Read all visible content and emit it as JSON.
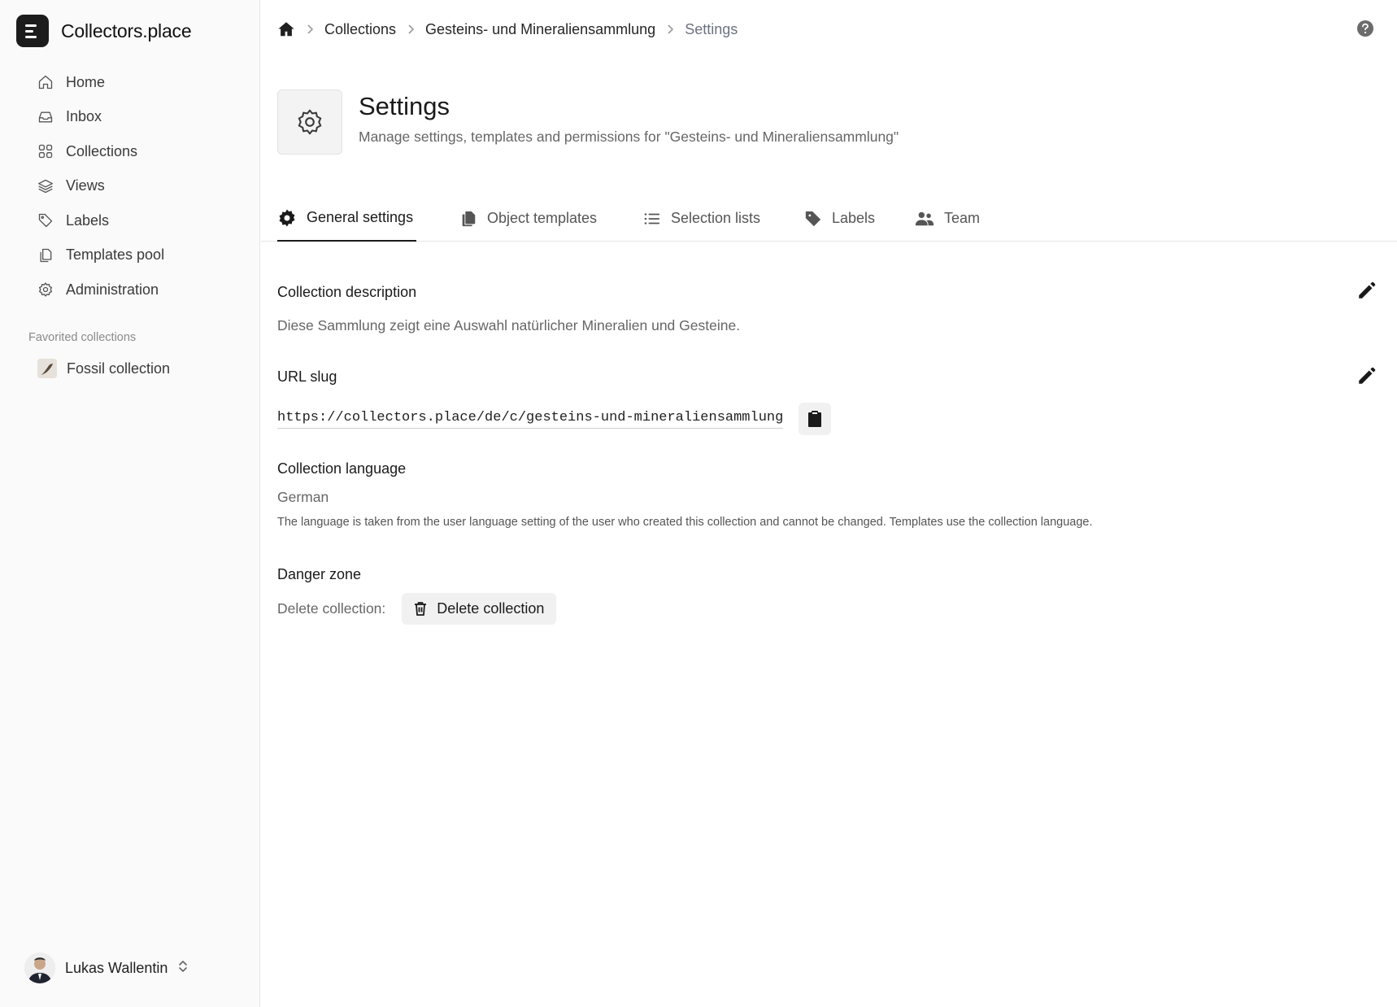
{
  "app": {
    "name": "Collectors.place"
  },
  "sidebar": {
    "items": [
      {
        "label": "Home",
        "icon": "home-icon"
      },
      {
        "label": "Inbox",
        "icon": "inbox-icon"
      },
      {
        "label": "Collections",
        "icon": "grid-icon"
      },
      {
        "label": "Views",
        "icon": "layers-icon"
      },
      {
        "label": "Labels",
        "icon": "tag-icon"
      },
      {
        "label": "Templates pool",
        "icon": "copy-icon"
      },
      {
        "label": "Administration",
        "icon": "gear-icon"
      }
    ],
    "favorites_title": "Favorited collections",
    "favorites": [
      {
        "label": "Fossil collection"
      }
    ],
    "user": {
      "name": "Lukas Wallentin"
    }
  },
  "breadcrumb": {
    "items": [
      "Collections",
      "Gesteins- und Mineraliensammlung"
    ],
    "current": "Settings"
  },
  "header": {
    "title": "Settings",
    "subtitle": "Manage settings, templates and permissions for \"Gesteins- und Mineraliensammlung\""
  },
  "tabs": [
    {
      "label": "General settings",
      "icon": "gear-solid-icon",
      "active": true
    },
    {
      "label": "Object templates",
      "icon": "copy-solid-icon",
      "active": false
    },
    {
      "label": "Selection lists",
      "icon": "list-icon",
      "active": false
    },
    {
      "label": "Labels",
      "icon": "tag-solid-icon",
      "active": false
    },
    {
      "label": "Team",
      "icon": "users-icon",
      "active": false
    }
  ],
  "settings": {
    "description": {
      "title": "Collection description",
      "value": "Diese Sammlung zeigt eine Auswahl natürlicher Mineralien und Gesteine."
    },
    "slug": {
      "title": "URL slug",
      "value": "https://collectors.place/de/c/gesteins-und-mineraliensammlung"
    },
    "language": {
      "title": "Collection language",
      "value": "German",
      "note": "The language is taken from the user language setting of the user who created this collection and cannot be changed. Templates use the collection language."
    },
    "danger": {
      "title": "Danger zone",
      "label": "Delete collection:",
      "button": "Delete collection"
    }
  },
  "colors": {
    "accent": "#1a1a1a",
    "sidebar_bg": "#fafafa",
    "muted_text": "#666666"
  }
}
